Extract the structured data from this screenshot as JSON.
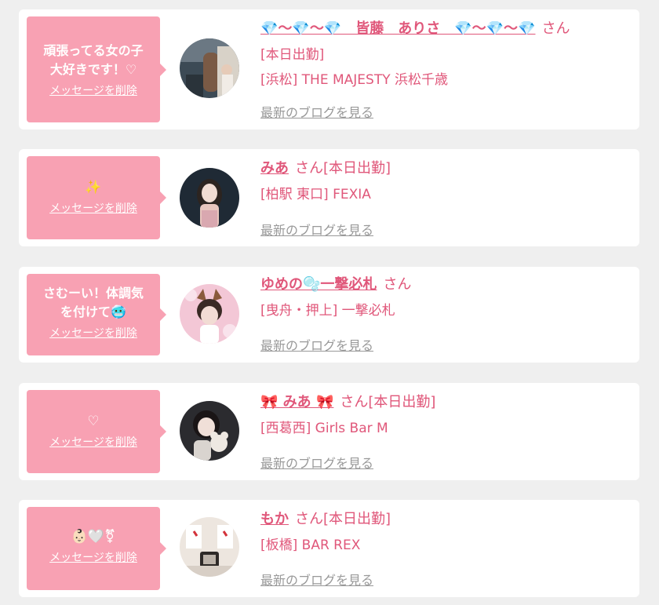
{
  "delete_label": "メッセージを削除",
  "blog_label": "最新のブログを見る",
  "san": "さん",
  "colors": {
    "accent": "#e0577a",
    "bubble": "#f8a1b3",
    "link_gray": "#999999",
    "background": "#efefef"
  },
  "cards": [
    {
      "message": "頑張ってる女の子\n大好きです！♡",
      "name": "💎〜💎〜💎　皆藤　ありさ　💎〜💎〜💎",
      "status": "[本日出勤]",
      "shop": "[浜松] THE MAJESTY 浜松千歳",
      "avatar_icon": "photo-avatar-arisa"
    },
    {
      "message": "✨",
      "name": "みあ",
      "status": "[本日出勤]",
      "shop": "[柏駅 東口] FEXIA",
      "avatar_icon": "photo-avatar-mia"
    },
    {
      "message": "さむーい！体調気\nを付けて🥶",
      "name": "ゆめの🫧一撃必札",
      "status": "",
      "shop": "[曳舟・押上] 一撃必札",
      "avatar_icon": "photo-avatar-yumeno"
    },
    {
      "message": "♡",
      "name": "🎀 みあ 🎀",
      "status": "[本日出勤]",
      "shop": "[西葛西] Girls Bar M",
      "avatar_icon": "photo-avatar-mia2"
    },
    {
      "message": "👶🏻🤍⚧",
      "name": "もか",
      "status": "[本日出勤]",
      "shop": "[板橋] BAR REX",
      "avatar_icon": "photo-avatar-moka"
    }
  ]
}
